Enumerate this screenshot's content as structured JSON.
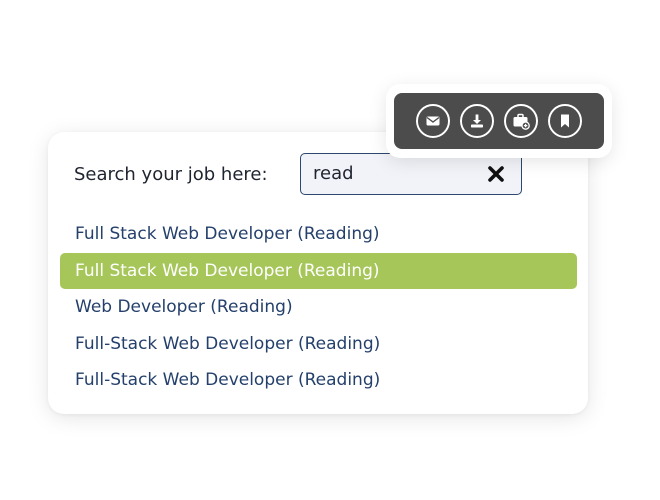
{
  "search": {
    "label": "Search your job here:",
    "value": "read"
  },
  "results": [
    {
      "label": "Full Stack Web Developer (Reading)",
      "highlighted": false
    },
    {
      "label": "Full Stack Web Developer (Reading)",
      "highlighted": true
    },
    {
      "label": "Web Developer (Reading)",
      "highlighted": false
    },
    {
      "label": "Full-Stack Web Developer (Reading)",
      "highlighted": false
    },
    {
      "label": "Full-Stack Web Developer (Reading)",
      "highlighted": false
    }
  ],
  "toolbar": {
    "icons": [
      "envelope-icon",
      "download-icon",
      "briefcase-add-icon",
      "bookmark-icon"
    ]
  },
  "colors": {
    "highlight": "#a6c659",
    "result_text": "#24406b",
    "toolbar_bg": "#4c4c4c",
    "input_border": "#2c4770"
  }
}
